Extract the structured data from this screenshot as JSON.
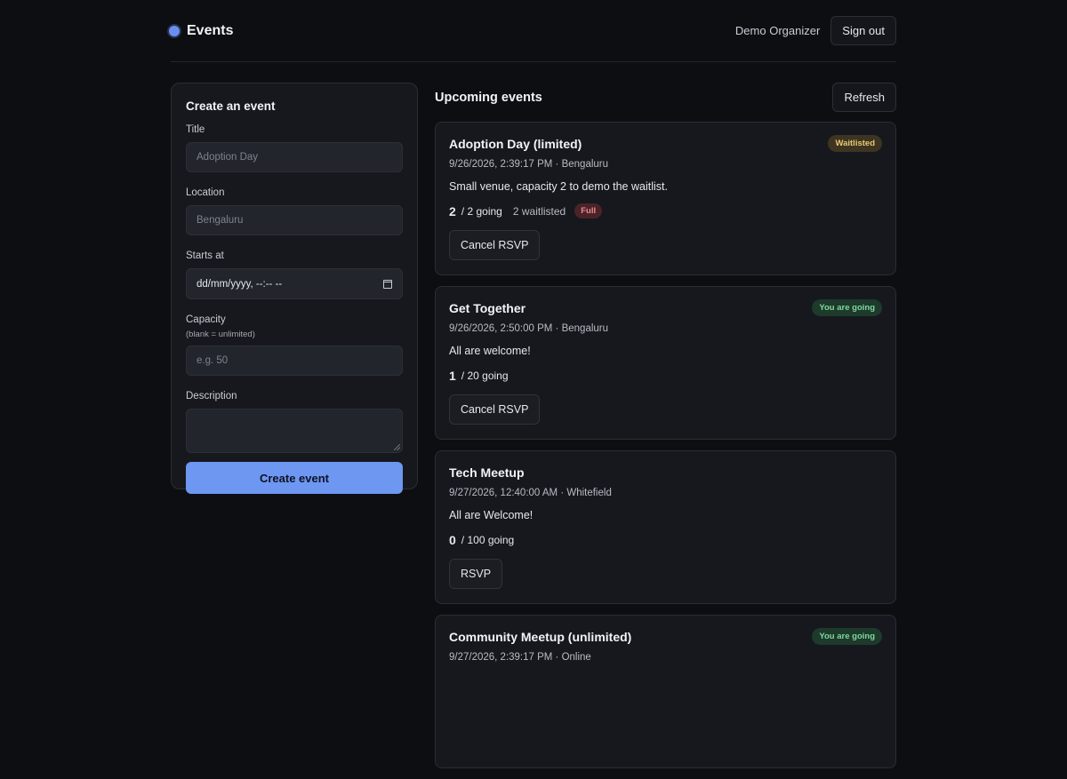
{
  "header": {
    "title": "Events",
    "user_name": "Demo Organizer",
    "sign_out_label": "Sign out"
  },
  "form": {
    "heading": "Create an event",
    "title_label": "Title",
    "title_placeholder": "Adoption Day",
    "location_label": "Location",
    "location_placeholder": "Bengaluru",
    "starts_label": "Starts at",
    "starts_placeholder": "dd/mm/yyyy, --:-- --",
    "capacity_label": "Capacity",
    "capacity_hint": "(blank = unlimited)",
    "capacity_placeholder": "e.g. 50",
    "description_label": "Description",
    "submit_label": "Create event"
  },
  "events_panel": {
    "title": "Upcoming events",
    "refresh_label": "Refresh"
  },
  "events": [
    {
      "title": "Adoption Day (limited)",
      "meta": "9/26/2026, 2:39:17 PM · Bengaluru",
      "description": "Small venue, capacity 2 to demo the waitlist.",
      "going_count": "2",
      "going_suffix": "/ 2 going",
      "waitlisted": "2 waitlisted",
      "full_label": "Full",
      "status": "Waitlisted",
      "action_label": "Cancel RSVP"
    },
    {
      "title": "Get Together",
      "meta": "9/26/2026, 2:50:00 PM · Bengaluru",
      "description": "All are welcome!",
      "going_count": "1",
      "going_suffix": "/ 20 going",
      "status": "You are going",
      "action_label": "Cancel RSVP"
    },
    {
      "title": "Tech Meetup",
      "meta": "9/27/2026, 12:40:00 AM · Whitefield",
      "description": "All are Welcome!",
      "going_count": "0",
      "going_suffix": "/ 100 going",
      "action_label": "RSVP"
    },
    {
      "title": "Community Meetup (unlimited)",
      "meta": "9/27/2026, 2:39:17 PM · Online",
      "status": "You are going"
    }
  ],
  "colors": {
    "accent": "#6e97f2",
    "background": "#0c0e12",
    "card": "#16181d",
    "waitlisted": "#e9c774",
    "going": "#7fd7a0",
    "full": "#ef8a90"
  }
}
